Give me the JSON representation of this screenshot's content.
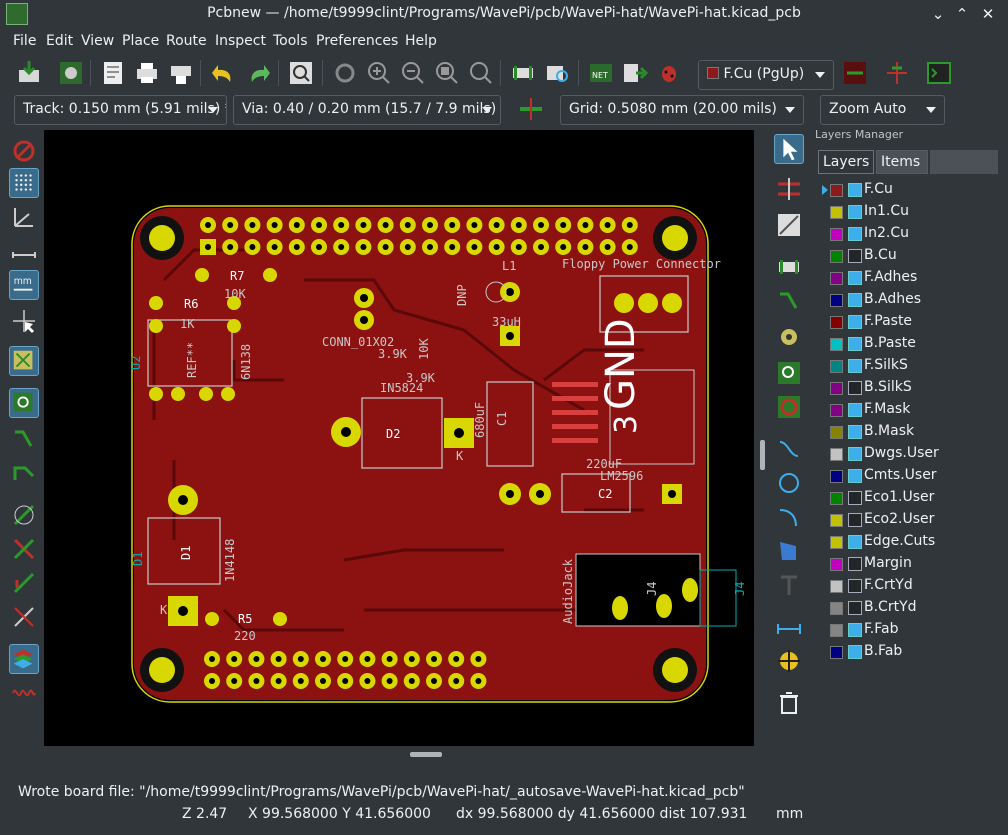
{
  "window": {
    "title": "Pcbnew — /home/t9999clint/Programs/WavePi/pcb/WavePi-hat/WavePi-hat.kicad_pcb"
  },
  "menu": [
    "File",
    "Edit",
    "View",
    "Place",
    "Route",
    "Inspect",
    "Tools",
    "Preferences",
    "Help"
  ],
  "toolbar": {
    "layer_select": "F.Cu (PgUp)",
    "track": "Track: 0.150 mm (5.91 mils) *",
    "via": "Via: 0.40 / 0.20 mm (15.7 / 7.9 mils) *",
    "grid": "Grid: 0.5080 mm (20.00 mils)",
    "zoom": "Zoom Auto"
  },
  "icons": {
    "toolbar": [
      "save-icon",
      "board-setup-icon",
      "page-settings-icon",
      "print-icon",
      "plot-icon",
      "undo-icon",
      "redo-icon",
      "find-icon",
      "redraw-icon",
      "zoom-in-icon",
      "zoom-out-icon",
      "zoom-fit-icon",
      "zoom-selection-icon",
      "footprint-editor-icon",
      "footprint-viewer-icon",
      "netlist-icon",
      "update-pcb-icon",
      "drc-icon",
      "layer-pair-icon",
      "microwave-icon",
      "scripting-console-icon"
    ],
    "left": [
      "drc-off-icon",
      "grid-icon",
      "polar-coords-icon",
      "inch-units-icon",
      "mm-units-icon",
      "cursor-shape-icon",
      "ratsnest-icon",
      "local-ratsnest-icon",
      "auto-delete-icon",
      "show-tracks-icon",
      "show-zones-icon",
      "zone-outline-icon",
      "zone-disable-icon",
      "pads-sketch-icon",
      "vias-sketch-icon",
      "tracks-sketch-icon",
      "high-contrast-icon",
      "microwave-toolbar-icon"
    ],
    "right": [
      "select-icon",
      "highlight-net-icon",
      "local-ratsnest-icon",
      "add-footprint-icon",
      "route-track-icon",
      "add-via-icon",
      "add-zone-icon",
      "add-keepout-icon",
      "add-line-icon",
      "add-circle-icon",
      "add-arc-icon",
      "add-polygon-icon",
      "add-text-icon",
      "add-dimension-icon",
      "add-target-icon",
      "delete-icon"
    ]
  },
  "pcb": {
    "labels": {
      "floppy": "Floppy Power Connector",
      "l1": "L1",
      "r7": "R7",
      "r7_val": "10K",
      "r6": "R6",
      "r6_val": "1K",
      "ref": "REF**",
      "u2": "U2",
      "ic_val": "6N138",
      "conn": "CONN_01X02",
      "dnp": "DNP",
      "v33": "33uH",
      "r39a": "3.9K",
      "r10k": "10K",
      "r39b": "3.9K",
      "in5824": "IN5824",
      "d2": "D2",
      "k1": "K",
      "c1_val": "680uF",
      "c1": "C1",
      "gnd": "GND",
      "three": "3",
      "c2_val": "220uF",
      "lm": "LM2596",
      "c2": "C2",
      "d1": "D1",
      "d1_side": "D1",
      "in4148": "1N4148",
      "k2": "K",
      "r5": "R5",
      "r5_val": "220",
      "audio": "AudioJack",
      "j4": "J4",
      "j4_side": "J4"
    }
  },
  "layers_manager": {
    "title": "Layers Manager",
    "tabs": [
      "Layers",
      "Items"
    ],
    "layers": [
      {
        "name": "F.Cu",
        "color": "#8c1a1a",
        "visible": true,
        "active": true
      },
      {
        "name": "In1.Cu",
        "color": "#c2c200",
        "visible": true
      },
      {
        "name": "In2.Cu",
        "color": "#c200c2",
        "visible": true
      },
      {
        "name": "B.Cu",
        "color": "#008400",
        "visible": false
      },
      {
        "name": "F.Adhes",
        "color": "#840084",
        "visible": true
      },
      {
        "name": "B.Adhes",
        "color": "#000084",
        "visible": true
      },
      {
        "name": "F.Paste",
        "color": "#840000",
        "visible": true
      },
      {
        "name": "B.Paste",
        "color": "#00c2c2",
        "visible": true
      },
      {
        "name": "F.SilkS",
        "color": "#008484",
        "visible": true
      },
      {
        "name": "B.SilkS",
        "color": "#840084",
        "visible": false
      },
      {
        "name": "F.Mask",
        "color": "#840084",
        "visible": true
      },
      {
        "name": "B.Mask",
        "color": "#848400",
        "visible": true
      },
      {
        "name": "Dwgs.User",
        "color": "#c2c2c2",
        "visible": true
      },
      {
        "name": "Cmts.User",
        "color": "#000084",
        "visible": true
      },
      {
        "name": "Eco1.User",
        "color": "#008400",
        "visible": false
      },
      {
        "name": "Eco2.User",
        "color": "#c2c200",
        "visible": false
      },
      {
        "name": "Edge.Cuts",
        "color": "#c2c200",
        "visible": true
      },
      {
        "name": "Margin",
        "color": "#c200c2",
        "visible": false
      },
      {
        "name": "F.CrtYd",
        "color": "#c2c2c2",
        "visible": false
      },
      {
        "name": "B.CrtYd",
        "color": "#848484",
        "visible": false
      },
      {
        "name": "F.Fab",
        "color": "#848484",
        "visible": true
      },
      {
        "name": "B.Fab",
        "color": "#000084",
        "visible": true
      }
    ]
  },
  "status": {
    "message": "Wrote board file: \"/home/t9999clint/Programs/WavePi/pcb/WavePi-hat/_autosave-WavePi-hat.kicad_pcb\"",
    "zoom": "Z 2.47",
    "xy": "X 99.568000  Y 41.656000",
    "dxy": "dx 99.568000  dy 41.656000  dist 107.931",
    "units": "mm"
  }
}
